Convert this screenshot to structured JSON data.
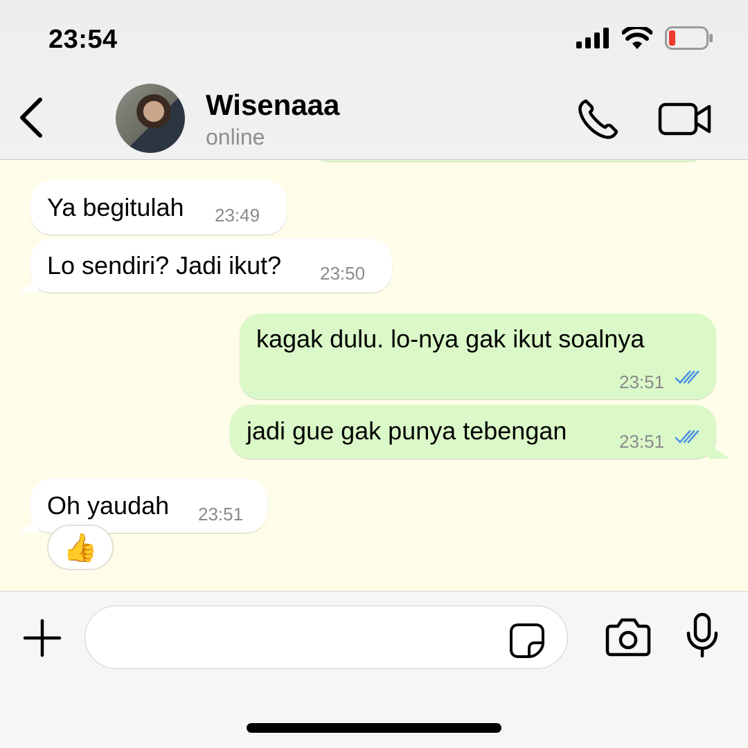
{
  "status_bar": {
    "time": "23:54",
    "icons": [
      "cellular-signal-icon",
      "wifi-icon",
      "battery-low-icon"
    ]
  },
  "header": {
    "contact_name": "Wisenaaa",
    "contact_status": "online",
    "icons": [
      "back-chevron-icon",
      "phone-icon",
      "video-camera-icon"
    ]
  },
  "messages": [
    {
      "direction": "incoming",
      "text": "Ya begitulah",
      "time": "23:49"
    },
    {
      "direction": "incoming",
      "text": "Lo sendiri? Jadi ikut?",
      "time": "23:50"
    },
    {
      "direction": "outgoing",
      "text": "kagak dulu. lo-nya gak ikut soalnya",
      "time": "23:51",
      "status": "read"
    },
    {
      "direction": "outgoing",
      "text": "jadi gue gak punya tebengan",
      "time": "23:51",
      "status": "read"
    },
    {
      "direction": "incoming",
      "text": "Oh yaudah",
      "time": "23:51",
      "reaction": "👍"
    }
  ],
  "input_bar": {
    "placeholder": "",
    "icons": [
      "plus-icon",
      "sticker-icon",
      "camera-icon",
      "microphone-icon"
    ]
  },
  "colors": {
    "chat_background": "#fdfde9",
    "incoming_bubble": "#ffffff",
    "outgoing_bubble": "#dbf9c8",
    "read_ticks": "#4a8fe6",
    "battery_low": "#ee3b2f"
  }
}
